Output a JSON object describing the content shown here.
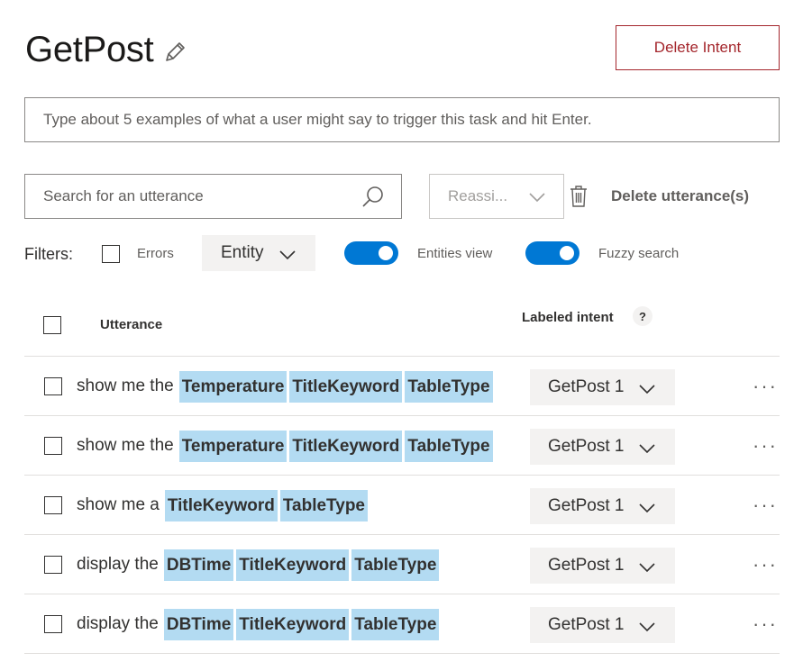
{
  "intent": {
    "name": "GetPost",
    "delete_label": "Delete Intent"
  },
  "examples_input": {
    "placeholder": "Type about 5 examples of what a user might say to trigger this task and hit Enter."
  },
  "toolbar": {
    "search_placeholder": "Search for an utterance",
    "reassign_label": "Reassi...",
    "delete_utterances_label": "Delete utterance(s)"
  },
  "filters": {
    "label": "Filters:",
    "errors_label": "Errors",
    "entity_dropdown": "Entity",
    "entities_view_label": "Entities view",
    "entities_view_on": true,
    "fuzzy_search_label": "Fuzzy search",
    "fuzzy_search_on": true
  },
  "table": {
    "col_utterance": "Utterance",
    "col_labeled_intent": "Labeled intent",
    "help_glyph": "?",
    "rows": [
      {
        "text": "show me the",
        "entities": [
          "Temperature",
          "TitleKeyword",
          "TableType"
        ],
        "intent": "GetPost 1"
      },
      {
        "text": "show me the",
        "entities": [
          "Temperature",
          "TitleKeyword",
          "TableType"
        ],
        "intent": "GetPost 1"
      },
      {
        "text": "show me a",
        "entities": [
          "TitleKeyword",
          "TableType"
        ],
        "intent": "GetPost 1"
      },
      {
        "text": "display the",
        "entities": [
          "DBTime",
          "TitleKeyword",
          "TableType"
        ],
        "intent": "GetPost 1"
      },
      {
        "text": "display the",
        "entities": [
          "DBTime",
          "TitleKeyword",
          "TableType"
        ],
        "intent": "GetPost 1"
      }
    ],
    "more_glyph": "···"
  },
  "colors": {
    "accent": "#0078d4",
    "danger": "#a4262c",
    "entity_highlight": "#b3dbf2"
  }
}
